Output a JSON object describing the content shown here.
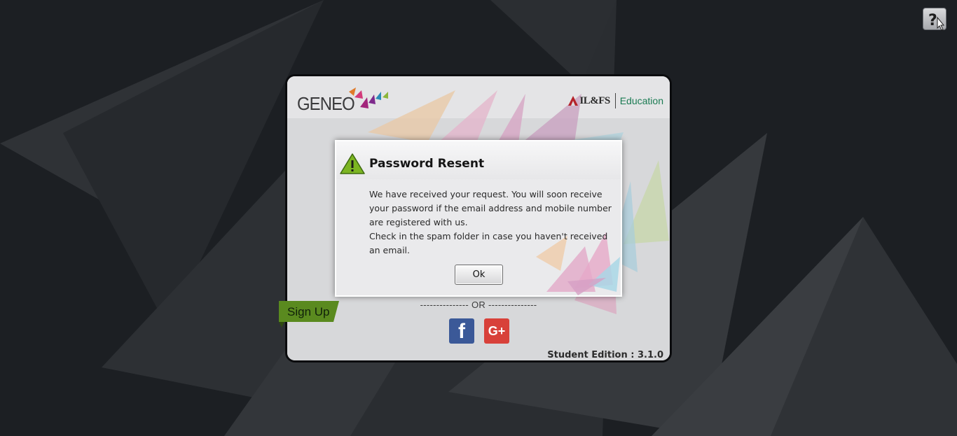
{
  "help": {
    "icon": "help-cursor-icon"
  },
  "brand": {
    "logo_text": "GENEO",
    "partner_text": "IL&FS",
    "partner_suffix": "Education"
  },
  "login": {
    "or_text": "--------------- OR ---------------",
    "facebook_icon": "facebook-icon",
    "facebook_glyph": "f",
    "google_icon": "google-plus-icon",
    "google_glyph": "G+",
    "signup_label": "Sign Up",
    "edition": "Student Edition : 3.1.0"
  },
  "dialog": {
    "icon": "warning-icon",
    "title": "Password Resent",
    "message_1": "We have received your request. You will soon receive your password if the email address and mobile number are registered with us.",
    "message_2": "Check in the spam folder in case you haven't received an email.",
    "ok_label": "Ok"
  },
  "colors": {
    "background": "#1c1f23",
    "dialog_bg": "#eaeaec",
    "signup_green": "#5a8a1f",
    "facebook_blue": "#3b5998",
    "google_red": "#d8413a",
    "edu_green": "#1b7b53"
  }
}
